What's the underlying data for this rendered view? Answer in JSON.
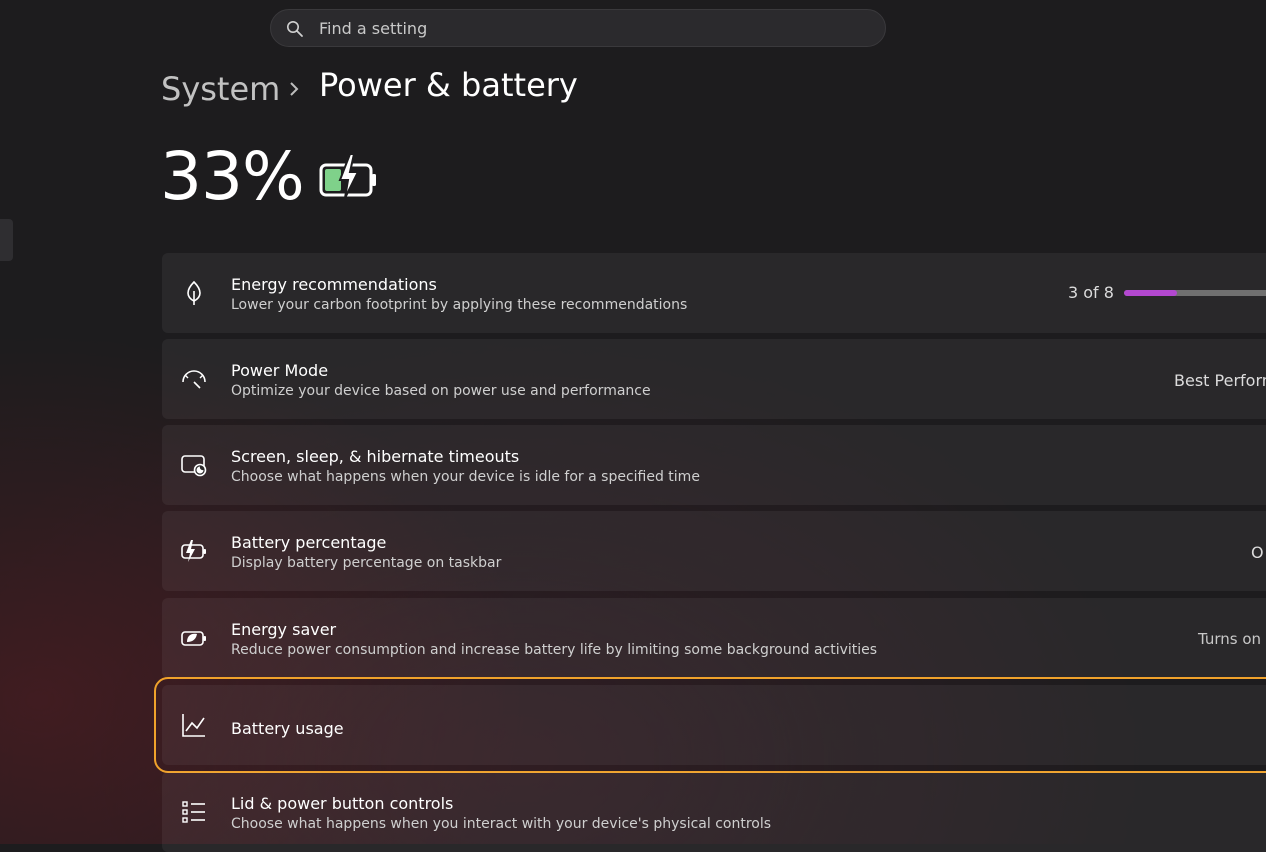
{
  "search": {
    "placeholder": "Find a setting"
  },
  "breadcrumb": {
    "parent": "System",
    "current": "Power & battery"
  },
  "battery": {
    "percent_label": "33%"
  },
  "settings": [
    {
      "title": "Energy recommendations",
      "desc": "Lower your carbon footprint by applying these recommendations",
      "right": "3 of 8",
      "progress": 0.375,
      "icon": "leaf-icon"
    },
    {
      "title": "Power Mode",
      "desc": "Optimize your device based on power use and performance",
      "right": "Best Perform",
      "icon": "power-mode-gauge-icon"
    },
    {
      "title": "Screen, sleep, & hibernate timeouts",
      "desc": "Choose what happens when your device is idle for a specified time",
      "right": "",
      "icon": "screen-sleep-icon"
    },
    {
      "title": "Battery percentage",
      "desc": "Display battery percentage on taskbar",
      "right": "O",
      "icon": "battery-percentage-icon"
    },
    {
      "title": "Energy saver",
      "desc": "Reduce power consumption and increase battery life by limiting some background activities",
      "right": "Turns on a",
      "icon": "energy-saver-icon"
    },
    {
      "title": "Battery usage",
      "desc": "",
      "right": "",
      "icon": "line-chart-icon"
    },
    {
      "title": "Lid & power button controls",
      "desc": "Choose what happens when you interact with your device's physical controls",
      "right": "",
      "icon": "list-controls-icon"
    }
  ],
  "colors": {
    "accent": "#b348d0",
    "highlight": "#f0a22b",
    "battery_fill": "#7fd18a"
  }
}
